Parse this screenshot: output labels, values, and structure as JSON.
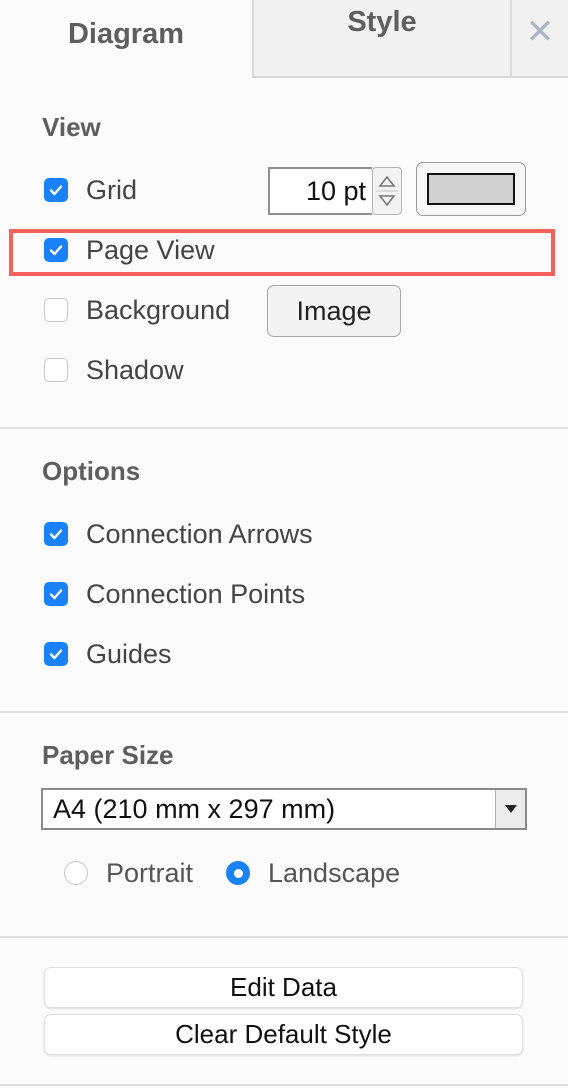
{
  "tabs": {
    "diagram": "Diagram",
    "style": "Style",
    "close": "✕"
  },
  "view": {
    "title": "View",
    "grid": {
      "label": "Grid",
      "checked": true,
      "size": "10 pt",
      "color": "#d0d0d0"
    },
    "page_view": {
      "label": "Page View",
      "checked": true
    },
    "background": {
      "label": "Background",
      "checked": false,
      "button": "Image"
    },
    "shadow": {
      "label": "Shadow",
      "checked": false
    }
  },
  "options": {
    "title": "Options",
    "items": [
      {
        "label": "Connection Arrows",
        "checked": true
      },
      {
        "label": "Connection Points",
        "checked": true
      },
      {
        "label": "Guides",
        "checked": true
      }
    ]
  },
  "paper": {
    "title": "Paper Size",
    "selected": "A4 (210 mm x 297 mm)",
    "orientation": {
      "portrait": "Portrait",
      "landscape": "Landscape",
      "selected": "Landscape"
    }
  },
  "buttons": {
    "edit_data": "Edit Data",
    "clear_style": "Clear Default Style"
  },
  "colors": {
    "accent": "#1a82f7",
    "highlight": "#f4605a"
  }
}
